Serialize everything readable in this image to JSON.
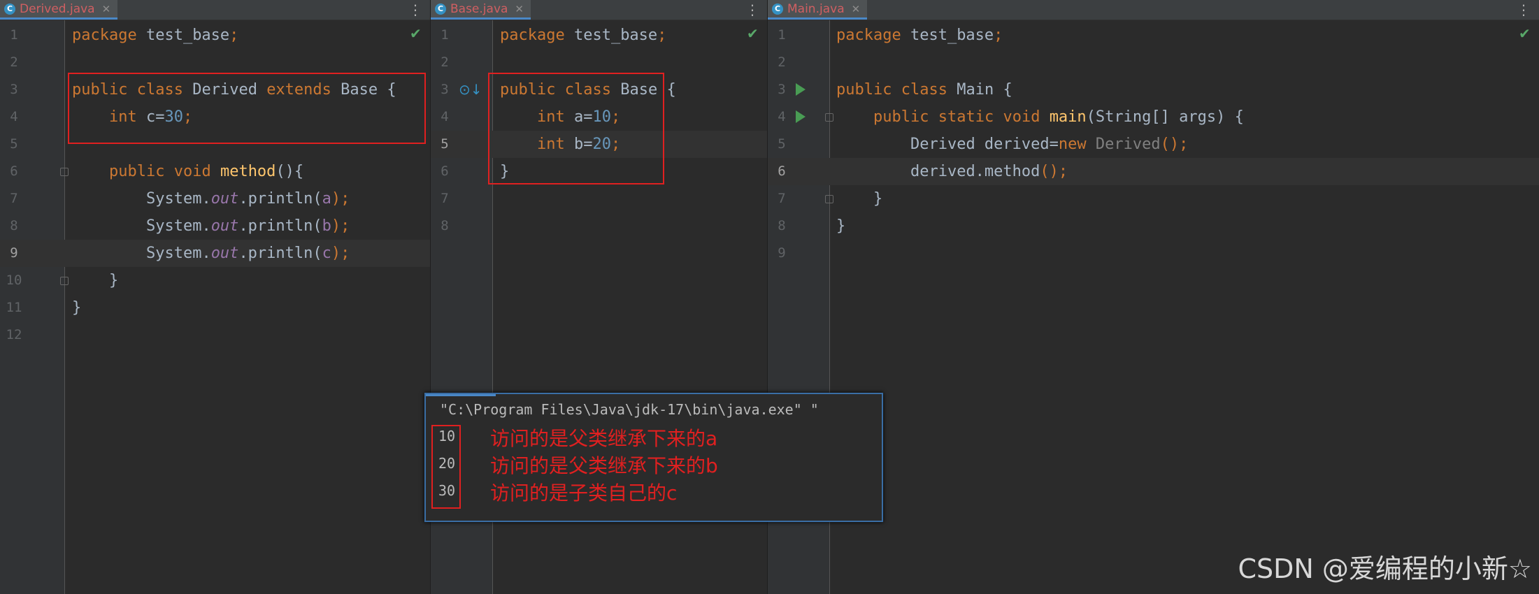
{
  "panes": [
    {
      "tab": {
        "label": "Derived.java",
        "icon": "C"
      },
      "lines": [
        "1",
        "2",
        "3",
        "4",
        "5",
        "6",
        "7",
        "8",
        "9",
        "10",
        "11",
        "12"
      ],
      "code": {
        "l1": {
          "k": "package",
          "t": " test_base",
          "s": ";"
        },
        "l3": {
          "k1": "public",
          "k2": "class",
          "t1": "Derived",
          "k3": "extends",
          "t2": "Base {"
        },
        "l4": {
          "k": "int",
          "t": " c=",
          "n": "30",
          "s": ";"
        },
        "l6": {
          "k1": "public",
          "k2": "void",
          "f": "method",
          "t": "(){"
        },
        "l7": {
          "t1": "System.",
          "fl": "out",
          "t2": ".println(",
          "v": "a",
          "t3": ");"
        },
        "l8": {
          "t1": "System.",
          "fl": "out",
          "t2": ".println(",
          "v": "b",
          "t3": ");"
        },
        "l9": {
          "t1": "System.",
          "fl": "out",
          "t2": ".println(",
          "v": "c",
          "t3": ");"
        },
        "l10": "}",
        "l11": "}"
      }
    },
    {
      "tab": {
        "label": "Base.java",
        "icon": "C"
      },
      "lines": [
        "1",
        "2",
        "3",
        "4",
        "5",
        "6",
        "7",
        "8"
      ],
      "code": {
        "l1": {
          "k": "package",
          "t": " test_base",
          "s": ";"
        },
        "l3": {
          "k1": "public",
          "k2": "class",
          "t": "Base {"
        },
        "l4": {
          "k": "int",
          "t": " a=",
          "n": "10",
          "s": ";"
        },
        "l5": {
          "k": "int",
          "t": " b=",
          "n": "20",
          "s": ";"
        },
        "l6": "}"
      }
    },
    {
      "tab": {
        "label": "Main.java",
        "icon": "C"
      },
      "lines": [
        "1",
        "2",
        "3",
        "4",
        "5",
        "6",
        "7",
        "8",
        "9"
      ],
      "code": {
        "l1": {
          "k": "package",
          "t": " test_base",
          "s": ";"
        },
        "l3": {
          "k1": "public",
          "k2": "class",
          "t": "Main {"
        },
        "l4": {
          "k1": "public",
          "k2": "static",
          "k3": "void",
          "f": "main",
          "t": "(String[] args) {"
        },
        "l5": {
          "t1": "Derived derived=",
          "k": "new",
          "g": " Derived",
          "t2": "();"
        },
        "l6": {
          "t1": "derived.method",
          "t2": "();"
        },
        "l7": "}",
        "l8": "}"
      }
    }
  ],
  "console": {
    "command": "\"C:\\Program Files\\Java\\jdk-17\\bin\\java.exe\" \"",
    "outputs": [
      "10",
      "20",
      "30"
    ],
    "annotations": [
      "访问的是父类继承下来的a",
      "访问的是父类继承下来的b",
      "访问的是子类自己的c"
    ]
  },
  "watermark": "CSDN @爱编程的小新☆",
  "icons": {
    "check": "checkmark-icon",
    "run": "run-icon",
    "menu": "more-vertical-icon",
    "close": "close-icon"
  },
  "colors": {
    "keyword": "#cc7832",
    "number": "#6897bb",
    "function": "#ffc66d",
    "field": "#9876aa",
    "annotation": "#e02020",
    "tab_active": "#d05f62"
  }
}
